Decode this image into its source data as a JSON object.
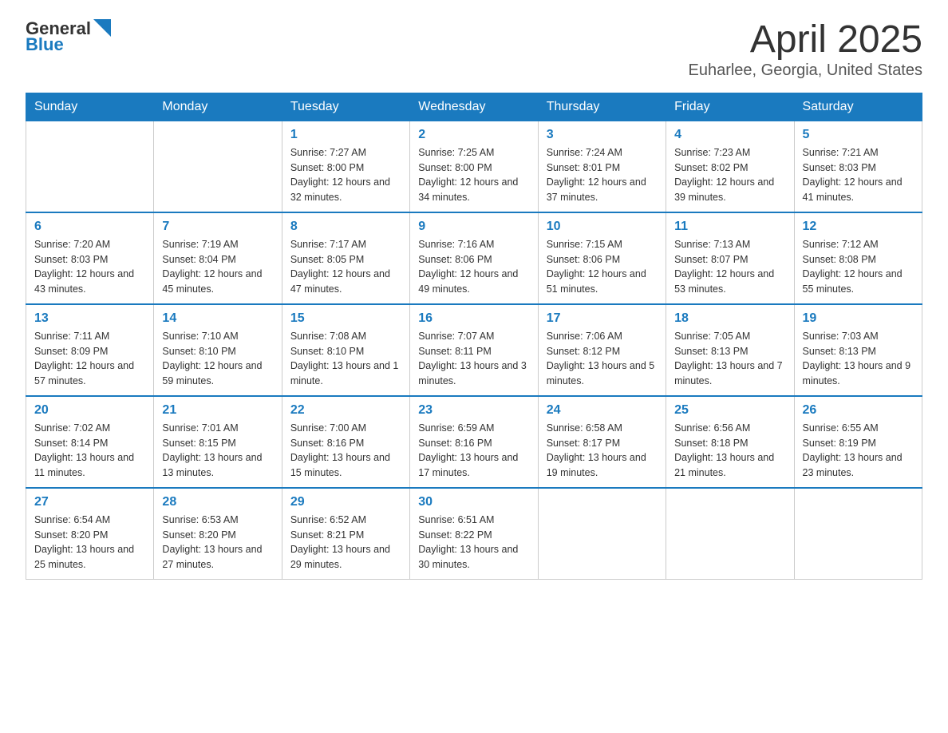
{
  "logo": {
    "text_general": "General",
    "text_blue": "Blue"
  },
  "title": "April 2025",
  "subtitle": "Euharlee, Georgia, United States",
  "days_of_week": [
    "Sunday",
    "Monday",
    "Tuesday",
    "Wednesday",
    "Thursday",
    "Friday",
    "Saturday"
  ],
  "weeks": [
    [
      {
        "day": "",
        "sunrise": "",
        "sunset": "",
        "daylight": ""
      },
      {
        "day": "",
        "sunrise": "",
        "sunset": "",
        "daylight": ""
      },
      {
        "day": "1",
        "sunrise": "Sunrise: 7:27 AM",
        "sunset": "Sunset: 8:00 PM",
        "daylight": "Daylight: 12 hours and 32 minutes."
      },
      {
        "day": "2",
        "sunrise": "Sunrise: 7:25 AM",
        "sunset": "Sunset: 8:00 PM",
        "daylight": "Daylight: 12 hours and 34 minutes."
      },
      {
        "day": "3",
        "sunrise": "Sunrise: 7:24 AM",
        "sunset": "Sunset: 8:01 PM",
        "daylight": "Daylight: 12 hours and 37 minutes."
      },
      {
        "day": "4",
        "sunrise": "Sunrise: 7:23 AM",
        "sunset": "Sunset: 8:02 PM",
        "daylight": "Daylight: 12 hours and 39 minutes."
      },
      {
        "day": "5",
        "sunrise": "Sunrise: 7:21 AM",
        "sunset": "Sunset: 8:03 PM",
        "daylight": "Daylight: 12 hours and 41 minutes."
      }
    ],
    [
      {
        "day": "6",
        "sunrise": "Sunrise: 7:20 AM",
        "sunset": "Sunset: 8:03 PM",
        "daylight": "Daylight: 12 hours and 43 minutes."
      },
      {
        "day": "7",
        "sunrise": "Sunrise: 7:19 AM",
        "sunset": "Sunset: 8:04 PM",
        "daylight": "Daylight: 12 hours and 45 minutes."
      },
      {
        "day": "8",
        "sunrise": "Sunrise: 7:17 AM",
        "sunset": "Sunset: 8:05 PM",
        "daylight": "Daylight: 12 hours and 47 minutes."
      },
      {
        "day": "9",
        "sunrise": "Sunrise: 7:16 AM",
        "sunset": "Sunset: 8:06 PM",
        "daylight": "Daylight: 12 hours and 49 minutes."
      },
      {
        "day": "10",
        "sunrise": "Sunrise: 7:15 AM",
        "sunset": "Sunset: 8:06 PM",
        "daylight": "Daylight: 12 hours and 51 minutes."
      },
      {
        "day": "11",
        "sunrise": "Sunrise: 7:13 AM",
        "sunset": "Sunset: 8:07 PM",
        "daylight": "Daylight: 12 hours and 53 minutes."
      },
      {
        "day": "12",
        "sunrise": "Sunrise: 7:12 AM",
        "sunset": "Sunset: 8:08 PM",
        "daylight": "Daylight: 12 hours and 55 minutes."
      }
    ],
    [
      {
        "day": "13",
        "sunrise": "Sunrise: 7:11 AM",
        "sunset": "Sunset: 8:09 PM",
        "daylight": "Daylight: 12 hours and 57 minutes."
      },
      {
        "day": "14",
        "sunrise": "Sunrise: 7:10 AM",
        "sunset": "Sunset: 8:10 PM",
        "daylight": "Daylight: 12 hours and 59 minutes."
      },
      {
        "day": "15",
        "sunrise": "Sunrise: 7:08 AM",
        "sunset": "Sunset: 8:10 PM",
        "daylight": "Daylight: 13 hours and 1 minute."
      },
      {
        "day": "16",
        "sunrise": "Sunrise: 7:07 AM",
        "sunset": "Sunset: 8:11 PM",
        "daylight": "Daylight: 13 hours and 3 minutes."
      },
      {
        "day": "17",
        "sunrise": "Sunrise: 7:06 AM",
        "sunset": "Sunset: 8:12 PM",
        "daylight": "Daylight: 13 hours and 5 minutes."
      },
      {
        "day": "18",
        "sunrise": "Sunrise: 7:05 AM",
        "sunset": "Sunset: 8:13 PM",
        "daylight": "Daylight: 13 hours and 7 minutes."
      },
      {
        "day": "19",
        "sunrise": "Sunrise: 7:03 AM",
        "sunset": "Sunset: 8:13 PM",
        "daylight": "Daylight: 13 hours and 9 minutes."
      }
    ],
    [
      {
        "day": "20",
        "sunrise": "Sunrise: 7:02 AM",
        "sunset": "Sunset: 8:14 PM",
        "daylight": "Daylight: 13 hours and 11 minutes."
      },
      {
        "day": "21",
        "sunrise": "Sunrise: 7:01 AM",
        "sunset": "Sunset: 8:15 PM",
        "daylight": "Daylight: 13 hours and 13 minutes."
      },
      {
        "day": "22",
        "sunrise": "Sunrise: 7:00 AM",
        "sunset": "Sunset: 8:16 PM",
        "daylight": "Daylight: 13 hours and 15 minutes."
      },
      {
        "day": "23",
        "sunrise": "Sunrise: 6:59 AM",
        "sunset": "Sunset: 8:16 PM",
        "daylight": "Daylight: 13 hours and 17 minutes."
      },
      {
        "day": "24",
        "sunrise": "Sunrise: 6:58 AM",
        "sunset": "Sunset: 8:17 PM",
        "daylight": "Daylight: 13 hours and 19 minutes."
      },
      {
        "day": "25",
        "sunrise": "Sunrise: 6:56 AM",
        "sunset": "Sunset: 8:18 PM",
        "daylight": "Daylight: 13 hours and 21 minutes."
      },
      {
        "day": "26",
        "sunrise": "Sunrise: 6:55 AM",
        "sunset": "Sunset: 8:19 PM",
        "daylight": "Daylight: 13 hours and 23 minutes."
      }
    ],
    [
      {
        "day": "27",
        "sunrise": "Sunrise: 6:54 AM",
        "sunset": "Sunset: 8:20 PM",
        "daylight": "Daylight: 13 hours and 25 minutes."
      },
      {
        "day": "28",
        "sunrise": "Sunrise: 6:53 AM",
        "sunset": "Sunset: 8:20 PM",
        "daylight": "Daylight: 13 hours and 27 minutes."
      },
      {
        "day": "29",
        "sunrise": "Sunrise: 6:52 AM",
        "sunset": "Sunset: 8:21 PM",
        "daylight": "Daylight: 13 hours and 29 minutes."
      },
      {
        "day": "30",
        "sunrise": "Sunrise: 6:51 AM",
        "sunset": "Sunset: 8:22 PM",
        "daylight": "Daylight: 13 hours and 30 minutes."
      },
      {
        "day": "",
        "sunrise": "",
        "sunset": "",
        "daylight": ""
      },
      {
        "day": "",
        "sunrise": "",
        "sunset": "",
        "daylight": ""
      },
      {
        "day": "",
        "sunrise": "",
        "sunset": "",
        "daylight": ""
      }
    ]
  ]
}
